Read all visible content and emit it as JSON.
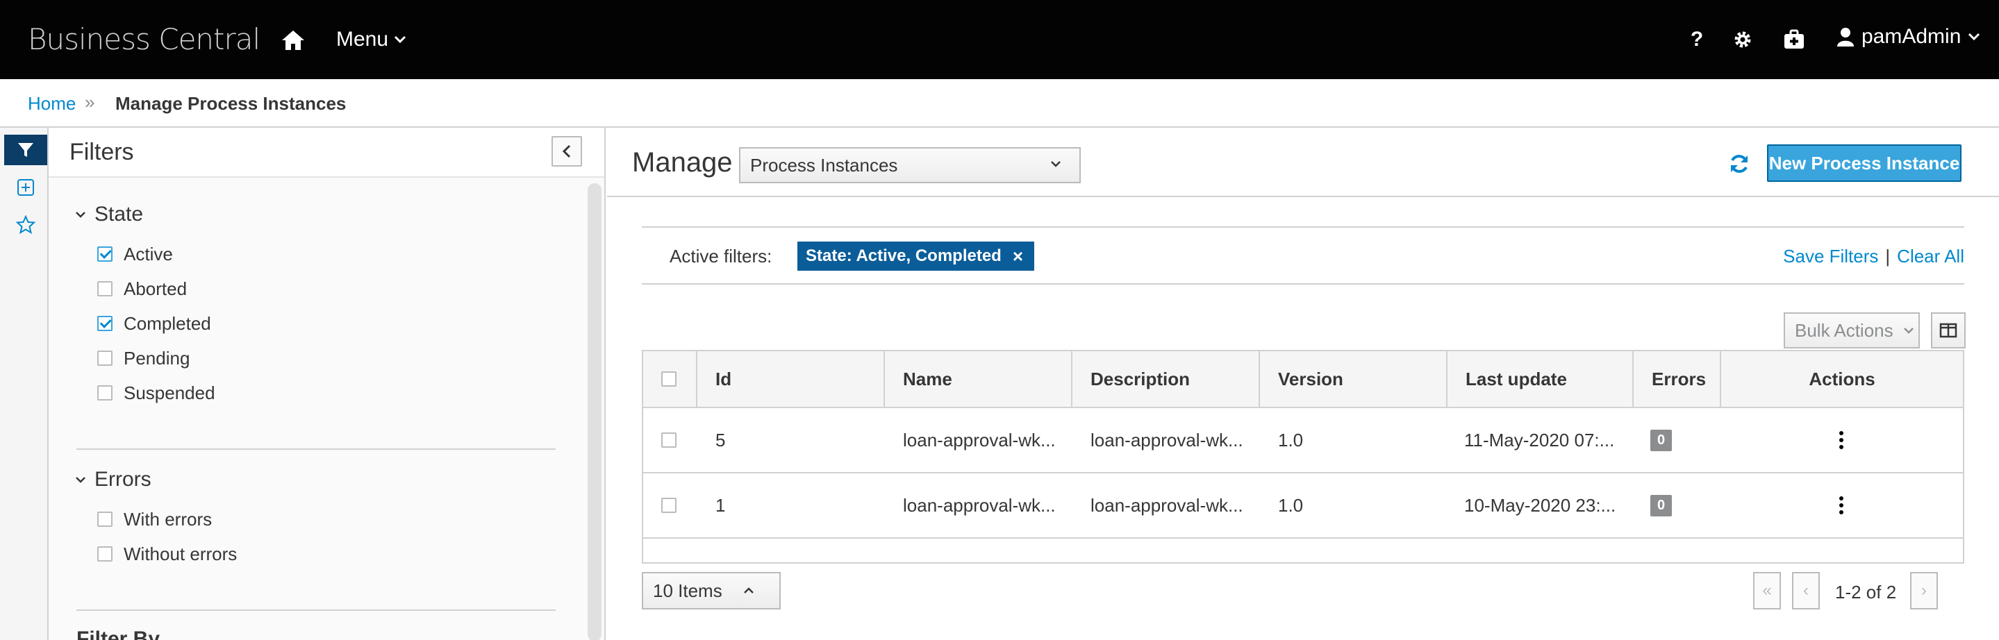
{
  "navbar": {
    "brand": "Business Central",
    "menu_label": "Menu",
    "help_label": "?",
    "user_label": "pamAdmin"
  },
  "breadcrumb": {
    "home": "Home",
    "separator": "»",
    "current": "Manage Process Instances"
  },
  "filters": {
    "title": "Filters",
    "groups": [
      {
        "title": "State",
        "options": [
          {
            "label": "Active",
            "checked": true
          },
          {
            "label": "Aborted",
            "checked": false
          },
          {
            "label": "Completed",
            "checked": true
          },
          {
            "label": "Pending",
            "checked": false
          },
          {
            "label": "Suspended",
            "checked": false
          }
        ]
      },
      {
        "title": "Errors",
        "options": [
          {
            "label": "With errors",
            "checked": false
          },
          {
            "label": "Without errors",
            "checked": false
          }
        ]
      }
    ],
    "next_group_title": "Filter By"
  },
  "main": {
    "title": "Manage",
    "select_value": "Process Instances",
    "new_button": "New Process Instance"
  },
  "active_filters": {
    "label": "Active filters:",
    "chip": "State: Active, Completed",
    "chip_close": "×",
    "save": "Save Filters",
    "pipe": "|",
    "clear": "Clear All"
  },
  "toolbar": {
    "bulk_actions": "Bulk Actions"
  },
  "table": {
    "headers": [
      "Id",
      "Name",
      "Description",
      "Version",
      "Last update",
      "Errors",
      "Actions"
    ],
    "rows": [
      {
        "id": "5",
        "name": "loan-approval-wk...",
        "description": "loan-approval-wk...",
        "version": "1.0",
        "last_update": "11-May-2020 07:...",
        "errors": "0"
      },
      {
        "id": "1",
        "name": "loan-approval-wk...",
        "description": "loan-approval-wk...",
        "version": "1.0",
        "last_update": "10-May-2020 23:...",
        "errors": "0"
      }
    ]
  },
  "pagination": {
    "page_size": "10 Items",
    "info": "1-2 of 2",
    "first": "«",
    "prev": "‹",
    "next": "›"
  },
  "colors": {
    "navbar_bg": "#030303",
    "link": "#0088ce",
    "primary_button": "#39a5dc",
    "chip_bg": "#0b5d99",
    "active_filter_icon_bg": "#0b3d66"
  }
}
